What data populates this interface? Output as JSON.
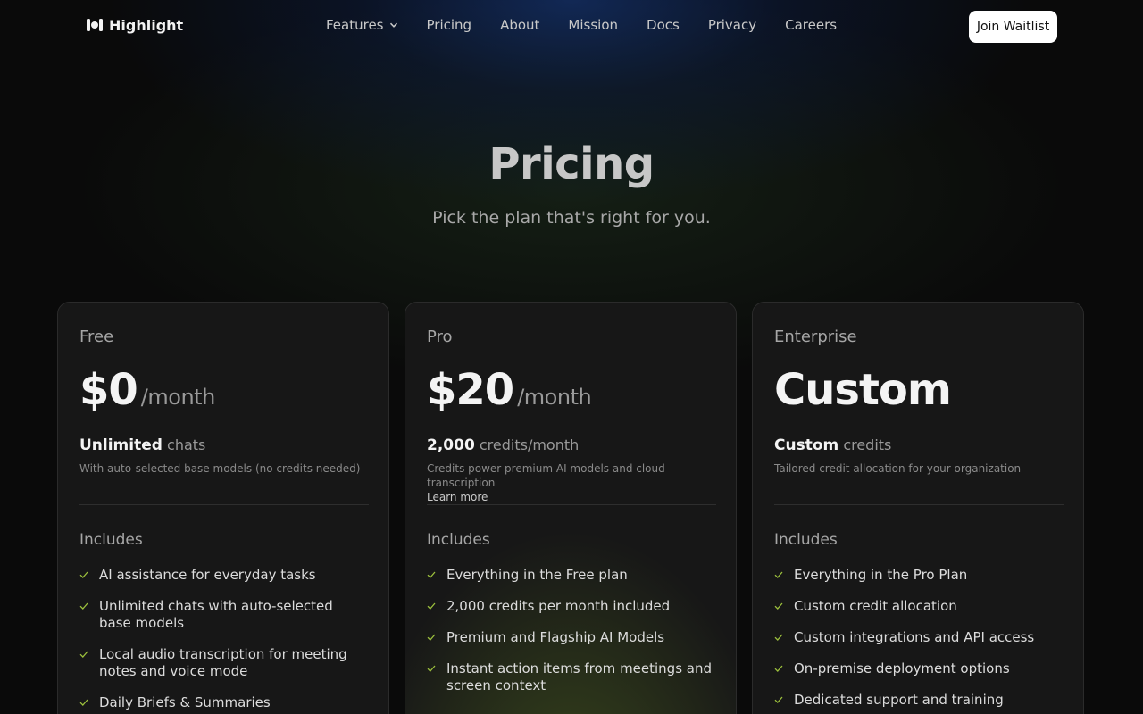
{
  "nav": {
    "logo_text": "Highlight",
    "links": [
      {
        "label": "Features"
      },
      {
        "label": "Pricing"
      },
      {
        "label": "About"
      },
      {
        "label": "Mission"
      },
      {
        "label": "Docs"
      },
      {
        "label": "Privacy"
      },
      {
        "label": "Careers"
      }
    ],
    "cta_label": "Join Waitlist"
  },
  "hero": {
    "title": "Pricing",
    "subtitle": "Pick the plan that's right for you."
  },
  "plans": [
    {
      "name": "Free",
      "price": "$0",
      "period": "/month",
      "credits_value": "Unlimited",
      "credits_unit": "chats",
      "credits_desc": "With auto-selected base models (no credits needed)",
      "learn_more": "",
      "includes_label": "Includes",
      "features": [
        "AI assistance for everyday tasks",
        "Unlimited chats with auto-selected base models",
        "Local audio transcription for meeting notes and voice mode",
        "Daily Briefs & Summaries"
      ]
    },
    {
      "name": "Pro",
      "price": "$20",
      "period": "/month",
      "credits_value": "2,000",
      "credits_unit": "credits/month",
      "credits_desc": "Credits power premium AI models and cloud transcription",
      "learn_more": "Learn more",
      "includes_label": "Includes",
      "features": [
        "Everything in the Free plan",
        "2,000 credits per month included",
        "Premium and Flagship AI Models",
        "Instant action items from meetings and screen context"
      ]
    },
    {
      "name": "Enterprise",
      "price": "Custom",
      "period": "",
      "credits_value": "Custom",
      "credits_unit": "credits",
      "credits_desc": "Tailored credit allocation for your organization",
      "learn_more": "",
      "includes_label": "Includes",
      "features": [
        "Everything in the Pro Plan",
        "Custom credit allocation",
        "Custom integrations and API access",
        "On-premise deployment options",
        "Dedicated support and training"
      ]
    }
  ],
  "colors": {
    "background": "#0a0a0a",
    "card": "#171717",
    "check": "#9bbf3c",
    "cta_bg": "#ffffff"
  }
}
